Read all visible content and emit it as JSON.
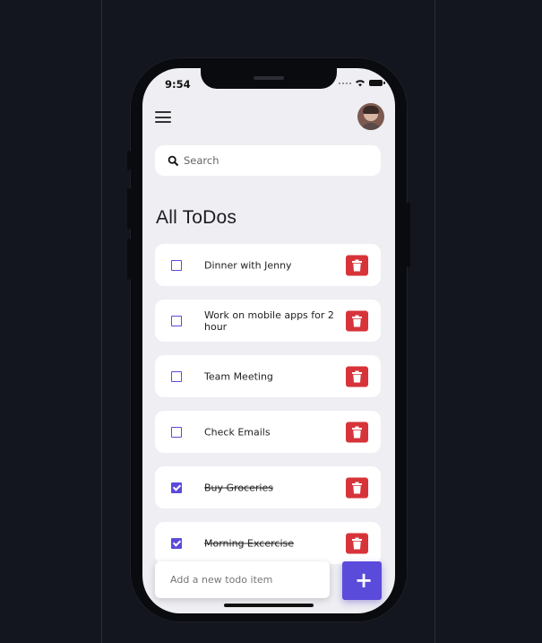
{
  "status_bar": {
    "time": "9:54"
  },
  "header": {
    "menu_icon": "hamburger-menu-icon",
    "avatar_icon": "user-avatar"
  },
  "search": {
    "placeholder": "Search",
    "icon": "search-icon"
  },
  "page_title": "All ToDos",
  "todos": [
    {
      "text": "Dinner with Jenny",
      "done": false
    },
    {
      "text": "Work on mobile apps for 2 hour",
      "done": false
    },
    {
      "text": "Team Meeting",
      "done": false
    },
    {
      "text": "Check Emails",
      "done": false
    },
    {
      "text": "Buy Groceries",
      "done": true
    },
    {
      "text": "Morning Excercise",
      "done": true
    }
  ],
  "new_todo": {
    "placeholder": "Add a new todo item",
    "add_label": "+"
  },
  "colors": {
    "accent": "#5b4bdb",
    "delete": "#d7343a",
    "screen_bg": "#eeeef3",
    "page_bg": "#13161f"
  }
}
